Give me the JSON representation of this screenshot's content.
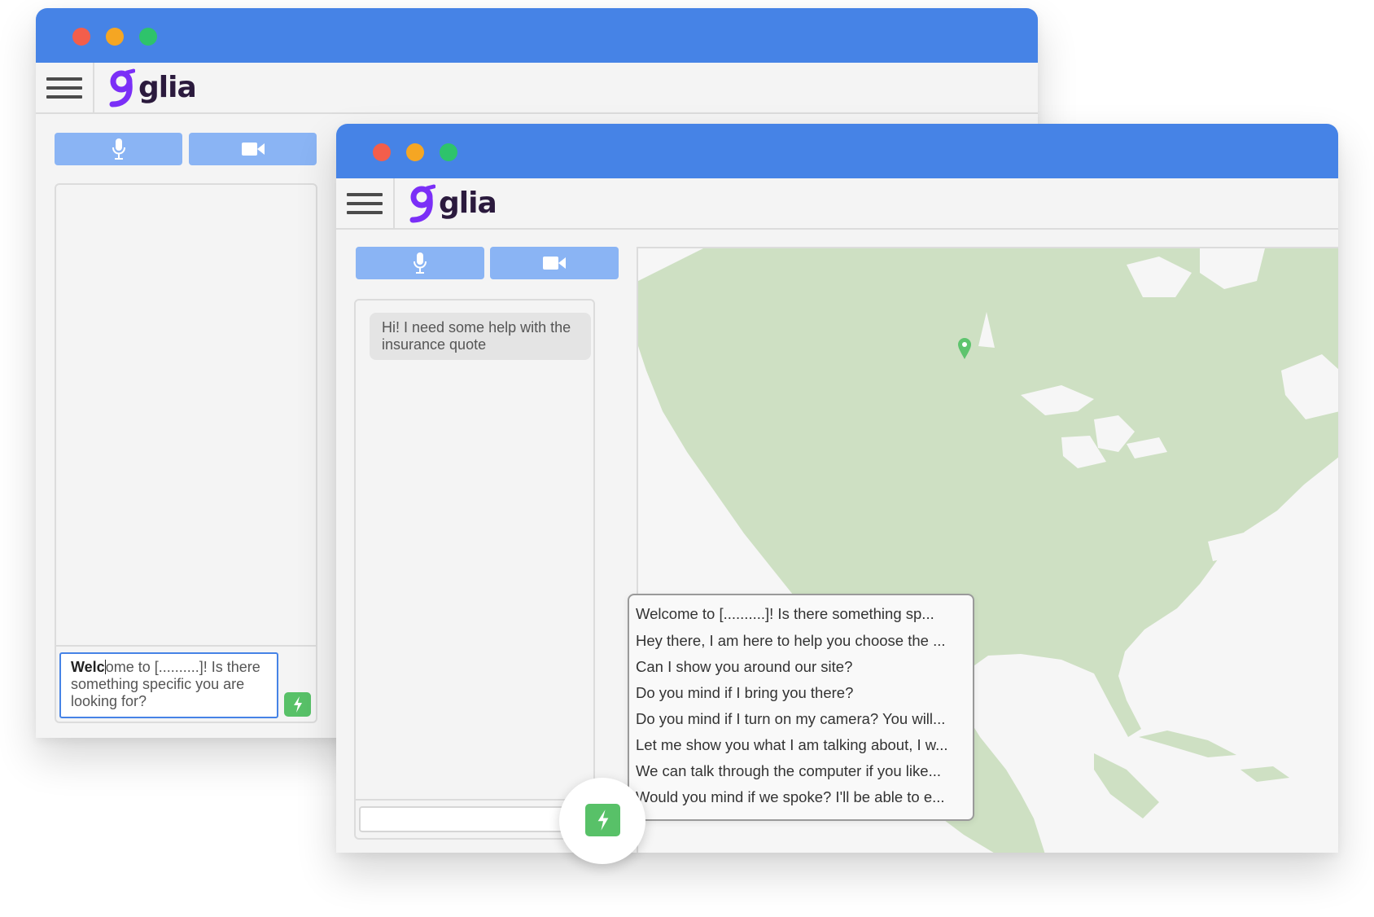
{
  "brand": {
    "name": "glia",
    "logo_color": "#7b2ff7",
    "titlebar_color": "#4683e6",
    "button_color": "#8ab4f4",
    "send_color": "#58c168"
  },
  "back_window": {
    "media_buttons": [
      "microphone-icon",
      "video-camera-icon"
    ],
    "composer": {
      "bold_text": "Welc",
      "rest_text": "ome to [..........]! Is there something specific you are looking for?"
    }
  },
  "front_window": {
    "media_buttons": [
      "microphone-icon",
      "video-camera-icon"
    ],
    "visitor_message": "Hi! I need some help with the insurance quote",
    "composer_value": "",
    "map_marker": "location-pin-icon",
    "canned_responses": [
      "Welcome to [..........]! Is there something sp...",
      "Hey there, I am here to help you choose the ...",
      "Can I show you around our site?",
      "Do you mind if I bring you there?",
      "Do you mind if I turn on my camera? You will...",
      "Let me show you what I am talking about, I w...",
      "We can talk through the computer if you like...",
      "Would you mind if we spoke? I'll be able to e..."
    ]
  }
}
